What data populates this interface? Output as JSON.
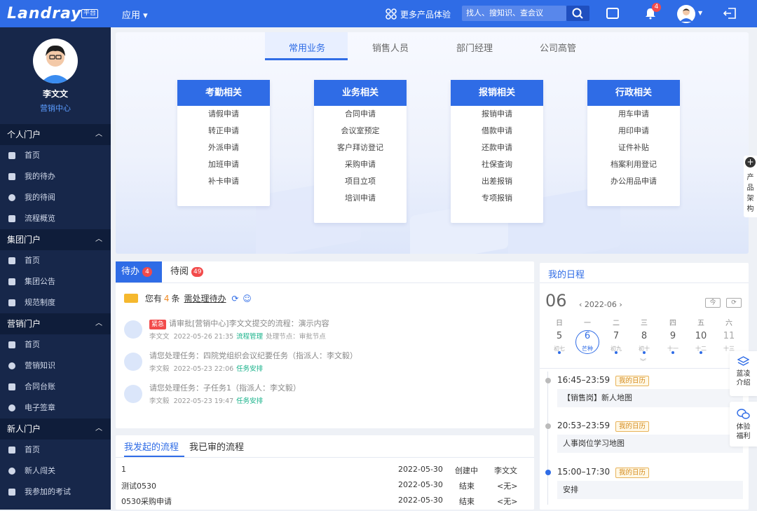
{
  "topbar": {
    "logo": "Landray",
    "logo_badge": "平台",
    "app_menu": "应用 ▾",
    "more_products": "更多产品体验",
    "search_placeholder": "找人、搜知识、查会议",
    "notification_count": "4"
  },
  "sidebar": {
    "user_name": "李文文",
    "department": "营销中心",
    "sections": [
      {
        "title": "个人门户",
        "items": [
          "首页",
          "我的待办",
          "我的待阅",
          "流程概览"
        ]
      },
      {
        "title": "集团门户",
        "items": [
          "首页",
          "集团公告",
          "规范制度"
        ]
      },
      {
        "title": "营销门户",
        "items": [
          "首页",
          "营销知识",
          "合同台账",
          "电子签章"
        ]
      },
      {
        "title": "新人门户",
        "items": [
          "首页",
          "新人闯关",
          "我参加的考试"
        ]
      }
    ]
  },
  "banner": {
    "tabs": [
      "常用业务",
      "销售人员",
      "部门经理",
      "公司高管"
    ],
    "cards": [
      {
        "title": "考勤相关",
        "items": [
          "请假申请",
          "转正申请",
          "外派申请",
          "加班申请",
          "补卡申请"
        ]
      },
      {
        "title": "业务相关",
        "items": [
          "合同申请",
          "会议室预定",
          "客户拜访登记",
          "采购申请",
          "项目立项",
          "培训申请"
        ]
      },
      {
        "title": "报销相关",
        "items": [
          "报销申请",
          "借款申请",
          "还款申请",
          "社保查询",
          "出差报销",
          "专项报销"
        ]
      },
      {
        "title": "行政相关",
        "items": [
          "用车申请",
          "用印申请",
          "证件补贴",
          "档案利用登记",
          "办公用品申请"
        ]
      }
    ]
  },
  "todo": {
    "tab_todo": "待办",
    "tab_todo_count": "4",
    "tab_read": "待阅",
    "tab_read_count": "49",
    "summary_prefix": "您有",
    "summary_count": "4",
    "summary_unit": "条",
    "summary_link": "需处理待办",
    "rows": [
      {
        "tag": "紧急",
        "title": "请审批[营销中心]李文文提交的流程：演示内容",
        "user": "李文文",
        "time": "2022-05-26 21:35",
        "category": "流程管理",
        "node": "处理节点：审批节点"
      },
      {
        "tag": "",
        "title": "请您处理任务：四院党组织会议纪要任务（指派人：李文毅）",
        "user": "李文毅",
        "time": "2022-05-23 22:06",
        "category": "任务安排",
        "node": ""
      },
      {
        "tag": "",
        "title": "请您处理任务：子任务1（指派人：李文毅）",
        "user": "李文毅",
        "time": "2022-05-23 19:47",
        "category": "任务安排",
        "node": ""
      }
    ]
  },
  "myflow": {
    "tab_started": "我发起的流程",
    "tab_reviewed": "我已审的流程",
    "rows": [
      {
        "name": "1",
        "date": "2022-05-30",
        "status": "创建中",
        "owner": "李文文"
      },
      {
        "name": "测试0530",
        "date": "2022-05-30",
        "status": "结束",
        "owner": "<无>"
      },
      {
        "name": "0530采购申请",
        "date": "2022-05-30",
        "status": "结束",
        "owner": "<无>"
      }
    ]
  },
  "schedule": {
    "title": "我的日程",
    "day": "06",
    "month": "2022-06",
    "btn_today": "今",
    "btn_refresh": "⟳",
    "weekdays": [
      "日",
      "一",
      "二",
      "三",
      "四",
      "五",
      "六"
    ],
    "dates": [
      "5",
      "6",
      "7",
      "8",
      "9",
      "10",
      "11"
    ],
    "lunar": [
      "初七",
      "芒种",
      "初九",
      "初十",
      "十一",
      "十二",
      "十三"
    ],
    "selected_index": 1,
    "expand": "︾",
    "events": [
      {
        "time": "16:45–23:59",
        "calendar": "我的日历",
        "content": "【销售岗】新人地图"
      },
      {
        "time": "20:53–23:59",
        "calendar": "我的日历",
        "content": "人事岗位学习地图"
      },
      {
        "time": "15:00–17:30",
        "calendar": "我的日历",
        "content": "安排"
      }
    ]
  },
  "floating": {
    "product_arch": "产品架构",
    "lanling_intro": "蓝凌介绍",
    "experience_benefit": "体验福利"
  },
  "colors": {
    "brand": "#2f6ce6",
    "sidebar": "#17274a",
    "badge": "#f24b4b",
    "accent_green": "#18b28a",
    "calendar_tag": "#d48a1c"
  }
}
